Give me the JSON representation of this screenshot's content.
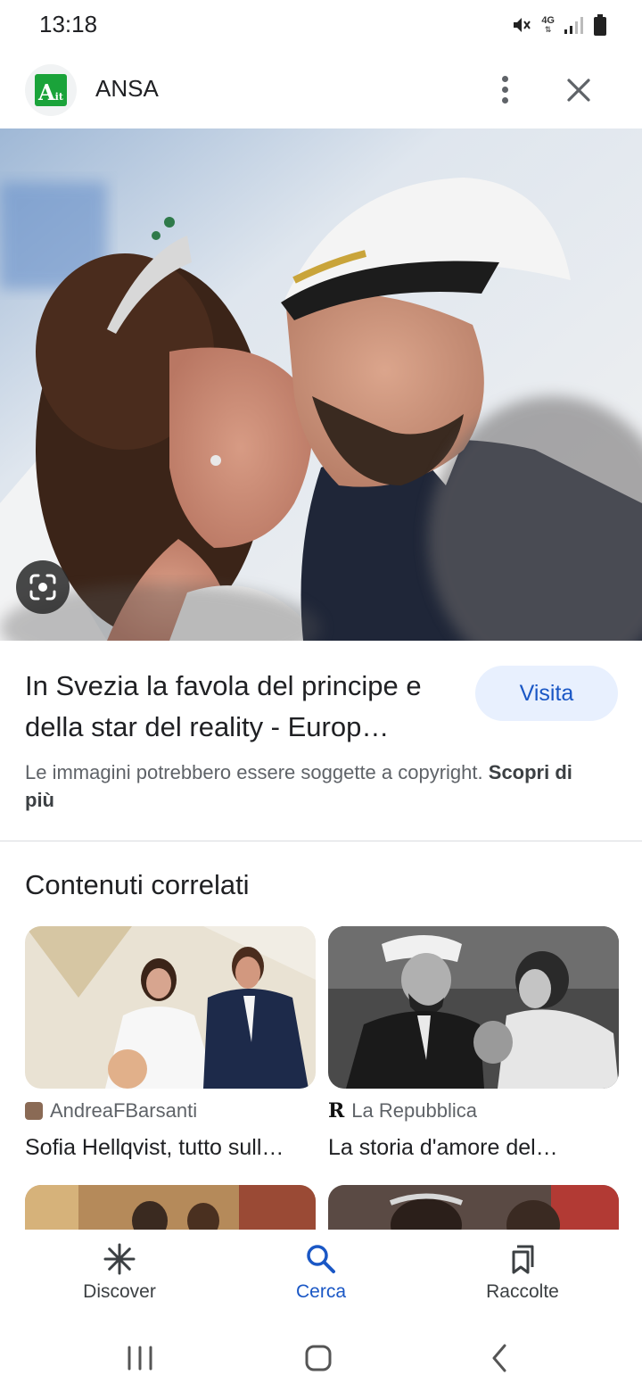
{
  "status_bar": {
    "time": "13:18",
    "network": "4G",
    "icons": [
      "mute-icon",
      "signal-icon",
      "battery-icon"
    ]
  },
  "header": {
    "logo_text_big": "A",
    "logo_text_small": "it",
    "source_name": "ANSA",
    "icons": [
      "more-vert-icon",
      "close-icon"
    ]
  },
  "article": {
    "title": "In Svezia la favola del principe e della star del reality - Europ…",
    "visit_label": "Visita",
    "copyright_text": "Le immagini potrebbero essere soggette a copyright.",
    "learn_more": "Scopri di più"
  },
  "related": {
    "heading": "Contenuti correlati",
    "cards": [
      {
        "source": "AndreaFBarsanti",
        "title": "Sofia Hellqvist, tutto sull…"
      },
      {
        "source": "La Repubblica",
        "source_logo": "R",
        "title": "La storia d'amore del…"
      }
    ]
  },
  "bottom_nav": {
    "items": [
      {
        "label": "Discover",
        "icon": "asterisk-icon"
      },
      {
        "label": "Cerca",
        "icon": "search-icon",
        "active": true
      },
      {
        "label": "Raccolte",
        "icon": "collections-icon"
      }
    ]
  },
  "colors": {
    "accent": "#1a57c5",
    "visit_bg": "#e8f0fe",
    "logo_green": "#1aa33a"
  }
}
